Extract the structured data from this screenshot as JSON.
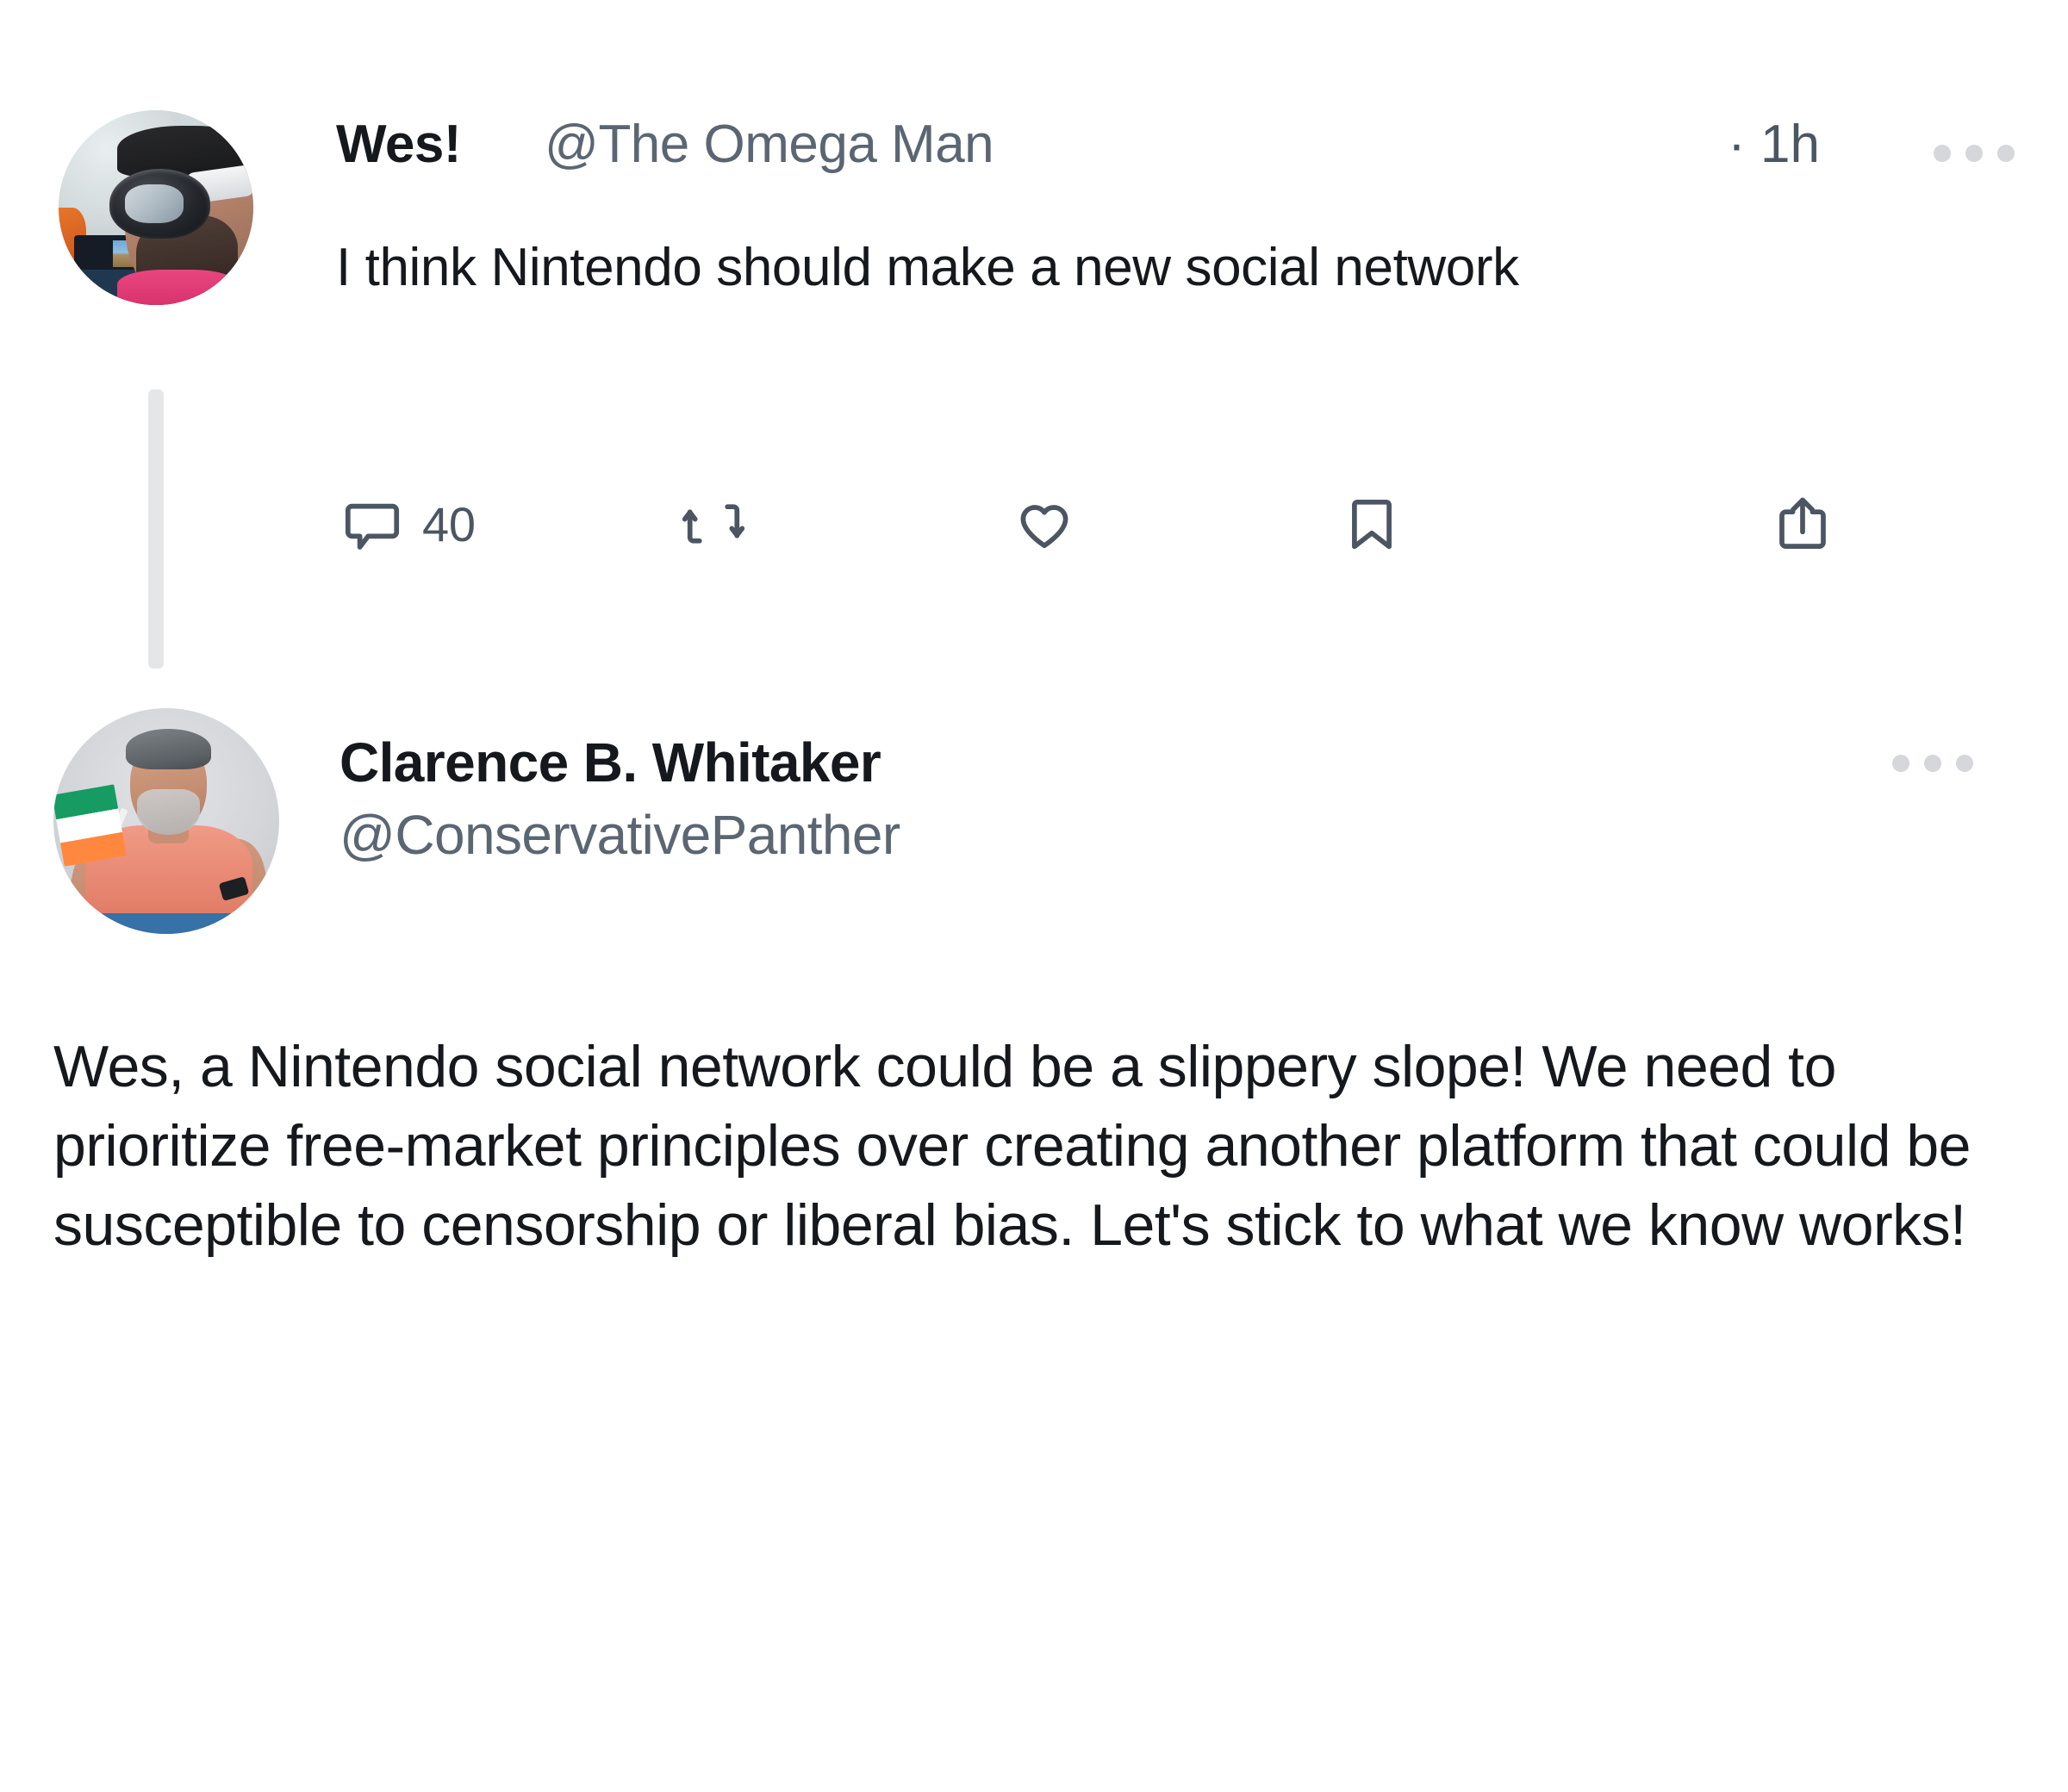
{
  "colors": {
    "background": "#ffffff",
    "text_primary": "#15181c",
    "text_secondary": "#5b6673",
    "icon": "#4c5663",
    "thread_line": "#e4e6e8",
    "menu_dots": "#d5d7da"
  },
  "tweets": [
    {
      "id": "tweet-one",
      "author": {
        "display_name": "Wes!",
        "handle": "@The Omega Man",
        "avatar_alt": "man-wearing-vr-headset-avatar"
      },
      "timestamp": "· 1h",
      "body": "I think Nintendo should make a new social network",
      "menu_icon": "more-options-icon",
      "actions": [
        {
          "name": "reply",
          "icon": "reply-icon",
          "count": "40"
        },
        {
          "name": "retweet",
          "icon": "retweet-icon",
          "count": ""
        },
        {
          "name": "like",
          "icon": "heart-icon",
          "count": ""
        },
        {
          "name": "bookmark",
          "icon": "bookmark-icon",
          "count": ""
        },
        {
          "name": "share",
          "icon": "share-icon",
          "count": ""
        }
      ]
    },
    {
      "id": "tweet-two",
      "author": {
        "display_name": "Clarence B. Whitaker",
        "handle": "@ConservativePanther",
        "avatar_alt": "man-with-irish-flag-avatar"
      },
      "timestamp": "",
      "body": "Wes, a Nintendo social network could be a slippery slope! We need to prioritize free-market principles over creating another platform that could be susceptible to censorship or liberal bias. Let's stick to what we know works!",
      "menu_icon": "more-options-icon",
      "actions": []
    }
  ]
}
